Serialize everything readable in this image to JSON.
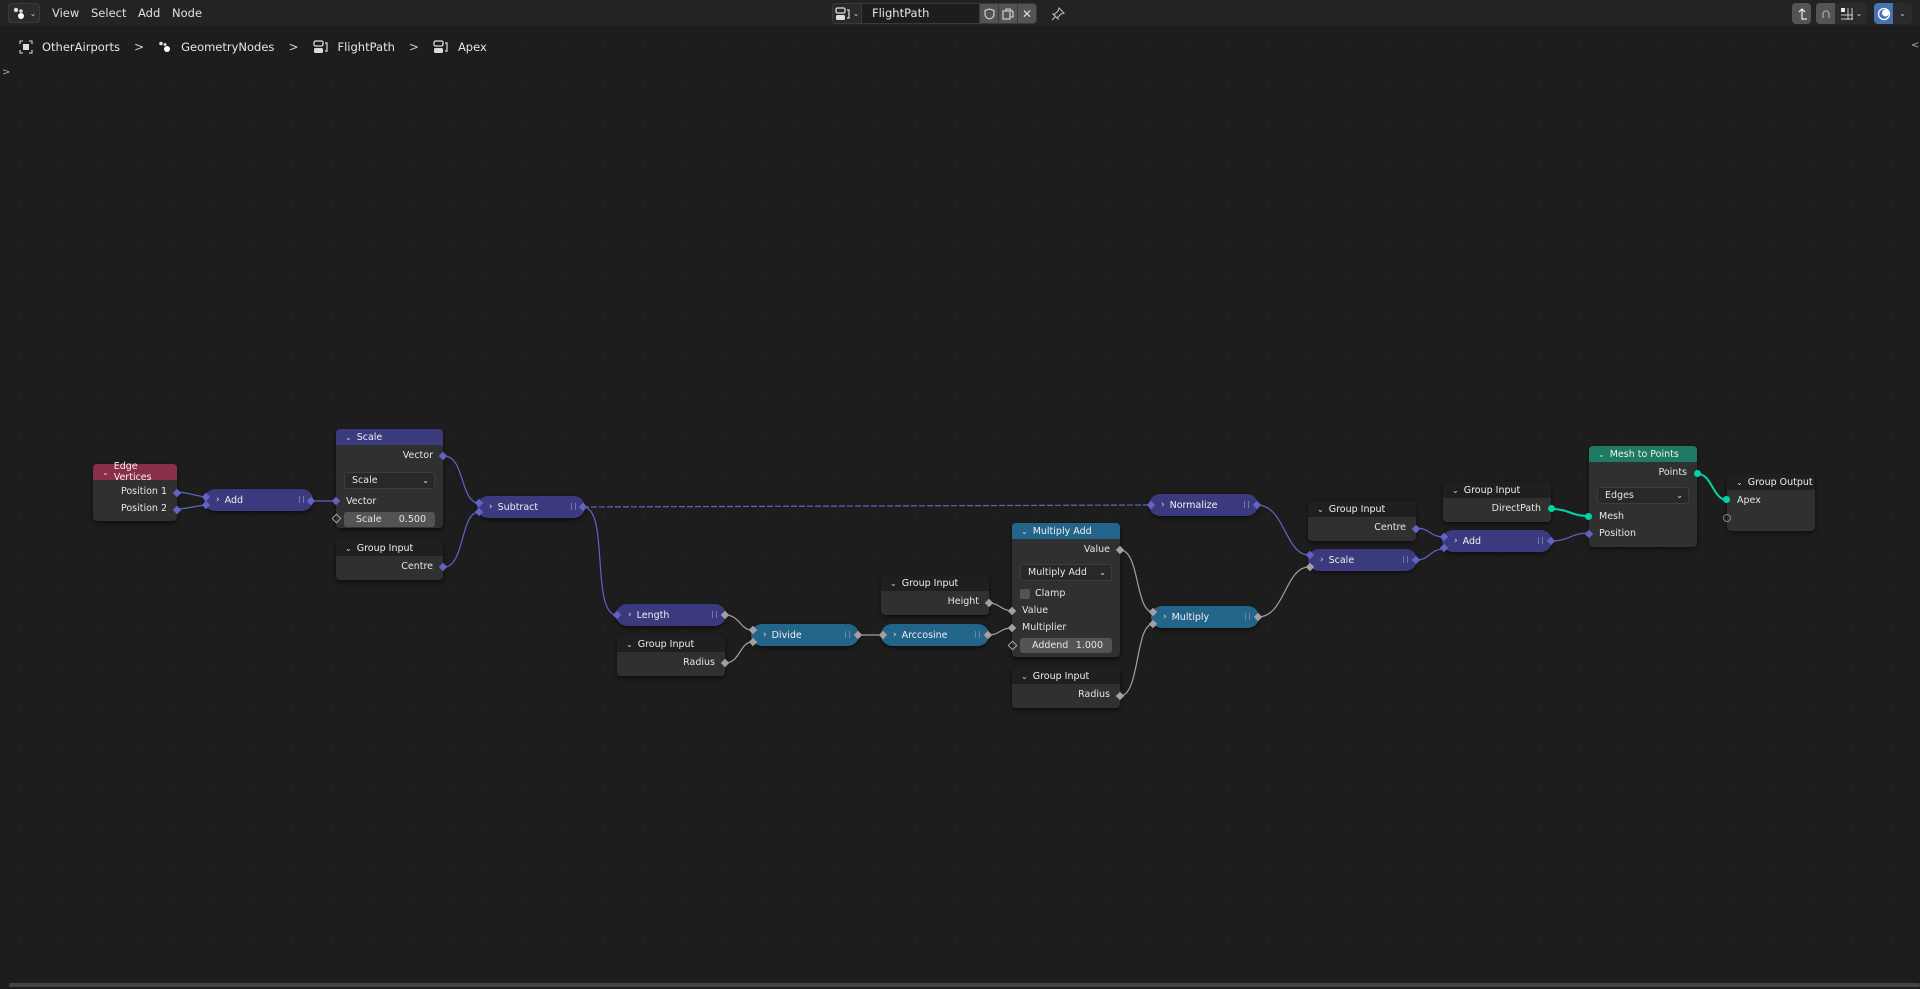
{
  "header": {
    "editor_type_icon": "node-editor-icon",
    "menu": [
      "View",
      "Select",
      "Add",
      "Node"
    ],
    "node_tree": {
      "type_icon": "node-tree-icon",
      "name": "FlightPath",
      "fake_user_icon": "shield-icon",
      "duplicate_icon": "duplicate-icon",
      "unlink_icon": "close-icon",
      "pin_icon": "pin-icon"
    },
    "right_tools": [
      "parent-node-tree-icon",
      "snap-icon",
      "snap-grid-icon",
      "overlay-icon"
    ]
  },
  "breadcrumb": [
    {
      "icon": "object-icon",
      "label": "OtherAirports"
    },
    {
      "icon": "geometry-nodes-icon",
      "label": "GeometryNodes"
    },
    {
      "icon": "node-tree-icon",
      "label": "FlightPath"
    },
    {
      "icon": "node-tree-icon",
      "label": "Apex"
    }
  ],
  "colors": {
    "vector_node": "#3b3a7e",
    "float_node": "#23648a",
    "input_node_header": "#8a2f4a",
    "geometry_node_header": "#1e7a62",
    "group_io_header": "#1f1f1f",
    "vector_socket": "#6363c7",
    "float_socket": "#a1a1a1",
    "geometry_socket": "#00d6a3"
  },
  "nodes": {
    "edge_vertices": {
      "title": "Edge Vertices",
      "outputs": [
        "Position 1",
        "Position 2"
      ]
    },
    "add1": {
      "title": "Add"
    },
    "scale1": {
      "title": "Scale",
      "output": "Vector",
      "mode": "Scale",
      "input": "Vector",
      "field_label": "Scale",
      "field_value": "0.500"
    },
    "gi_centre1": {
      "title": "Group Input",
      "output": "Centre"
    },
    "subtract": {
      "title": "Subtract"
    },
    "length": {
      "title": "Length"
    },
    "gi_radius1": {
      "title": "Group Input",
      "output": "Radius"
    },
    "divide": {
      "title": "Divide"
    },
    "arccosine": {
      "title": "Arccosine"
    },
    "gi_height": {
      "title": "Group Input",
      "output": "Height"
    },
    "multiply_add": {
      "title": "Multiply Add",
      "output": "Value",
      "mode": "Multiply Add",
      "clamp_label": "Clamp",
      "clamp_checked": false,
      "inputs": [
        "Value",
        "Multiplier"
      ],
      "field_label": "Addend",
      "field_value": "1.000"
    },
    "gi_radius2": {
      "title": "Group Input",
      "output": "Radius"
    },
    "multiply": {
      "title": "Multiply"
    },
    "normalize": {
      "title": "Normalize"
    },
    "gi_centre2": {
      "title": "Group Input",
      "output": "Centre"
    },
    "scale2": {
      "title": "Scale"
    },
    "gi_directpath": {
      "title": "Group Input",
      "output": "DirectPath"
    },
    "add2": {
      "title": "Add"
    },
    "mesh_to_points": {
      "title": "Mesh to Points",
      "output": "Points",
      "mode": "Edges",
      "inputs": [
        "Mesh",
        "Position"
      ]
    },
    "group_output": {
      "title": "Group Output",
      "input": "Apex"
    }
  }
}
